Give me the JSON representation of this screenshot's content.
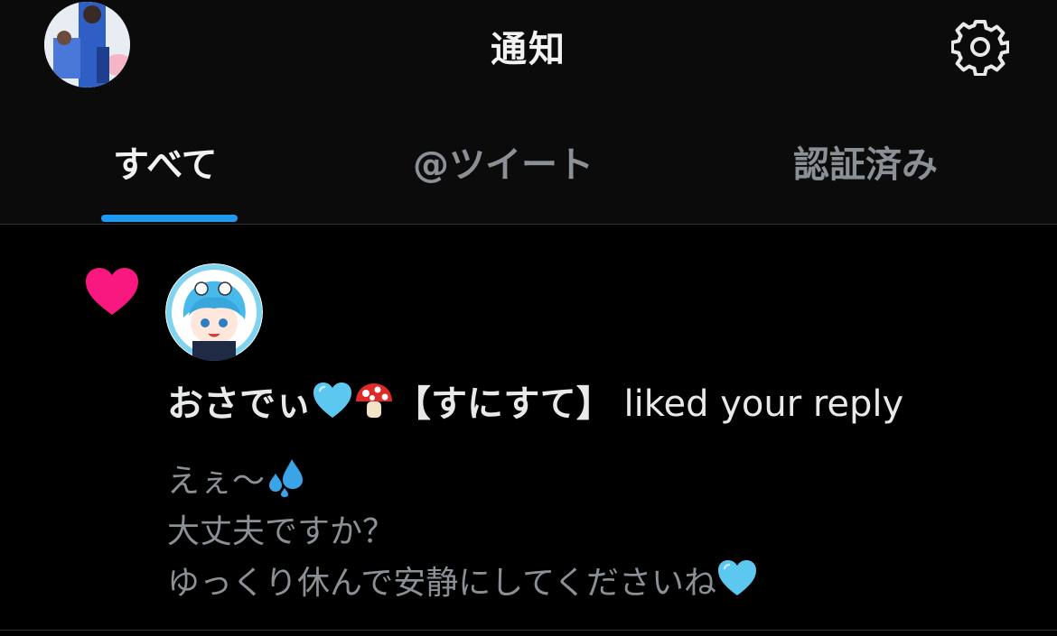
{
  "header": {
    "title": "通知",
    "settings_icon": "gear-icon",
    "avatar": "profile-avatar"
  },
  "tabs": [
    {
      "label": "すべて",
      "active": true
    },
    {
      "label": "@ツイート",
      "active": false
    },
    {
      "label": "認証済み",
      "active": false
    }
  ],
  "colors": {
    "accent": "#1d9bf0",
    "like_heart": "#f91880",
    "background": "#000000",
    "muted_text": "#8b9096"
  },
  "notification": {
    "type_icon": "heart-icon",
    "user_name_part1": "おさでぃ",
    "user_name_part2": "【すにすて】",
    "action": " liked your reply",
    "user_emojis": [
      "light-blue-heart-emoji",
      "mushroom-emoji"
    ],
    "reply": {
      "line1": "えぇ〜",
      "line1_emoji": "sweat-droplets-emoji",
      "line2": "大丈夫ですか？",
      "line3": "ゆっくり休んで安静にしてくださいね",
      "line3_emoji": "light-blue-heart-emoji"
    }
  }
}
